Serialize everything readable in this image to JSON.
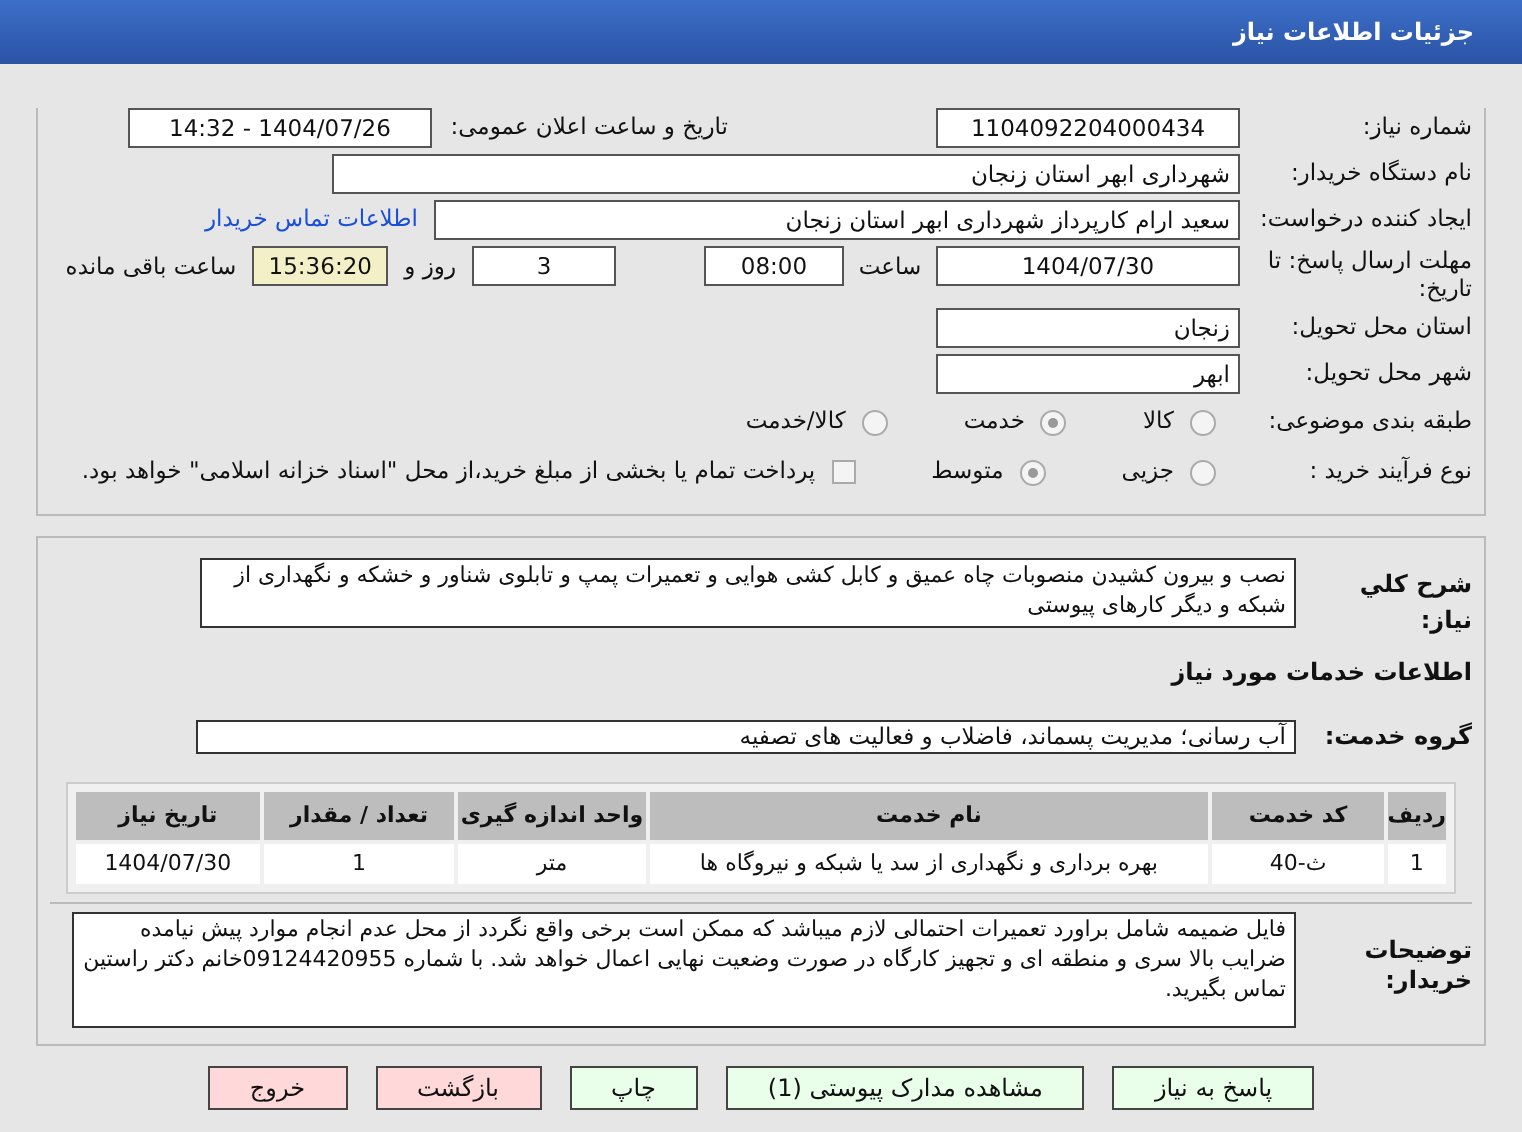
{
  "header": {
    "title": "جزئیات اطلاعات نیاز"
  },
  "need_number": {
    "label": "شماره نیاز:",
    "value": "1104092204000434"
  },
  "announce_date": {
    "label": "تاریخ و ساعت اعلان عمومی:",
    "value": "1404/07/26 - 14:32"
  },
  "buyer_org": {
    "label": "نام دستگاه خریدار:",
    "value": "شهرداری ابهر استان زنجان"
  },
  "requester": {
    "label": "ایجاد کننده درخواست:",
    "value": "سعید ارام کارپرداز  شهرداری ابهر استان زنجان",
    "link": "اطلاعات تماس خریدار"
  },
  "deadline": {
    "label": "مهلت ارسال پاسخ: تا تاریخ:",
    "date": "1404/07/30",
    "time_label": "ساعت",
    "time": "08:00",
    "days": "3",
    "days_label": "روز و",
    "remaining": "15:36:20",
    "remaining_label": "ساعت باقی مانده"
  },
  "province": {
    "label": "استان محل تحویل:",
    "value": "زنجان"
  },
  "city": {
    "label": "شهر محل تحویل:",
    "value": "ابهر"
  },
  "category": {
    "label": "طبقه بندی موضوعی:",
    "options": [
      {
        "label": "کالا",
        "selected": false
      },
      {
        "label": "خدمت",
        "selected": true
      },
      {
        "label": "کالا/خدمت",
        "selected": false
      }
    ]
  },
  "purchase_type": {
    "label": "نوع فرآیند خرید :",
    "options": [
      {
        "label": "جزیی",
        "selected": false
      },
      {
        "label": "متوسط",
        "selected": true
      }
    ],
    "payment_checkbox": {
      "checked": false,
      "label": "پرداخت تمام یا بخشی از مبلغ خرید،از محل \"اسناد خزانه اسلامی\" خواهد بود."
    }
  },
  "summary": {
    "label": "شرح کلي نياز:",
    "value": "نصب و بیرون کشیدن منصوبات چاه عمیق و کابل کشی هوایی و تعمیرات پمپ و تابلوی شناور و خشکه و نگهداری از شبکه و دیگر کارهای پیوستی"
  },
  "services_heading": "اطلاعات خدمات مورد نیاز",
  "service_group": {
    "label": "گروه خدمت:",
    "value": "آب رسانی؛ مدیریت پسماند، فاضلاب و فعالیت های تصفیه"
  },
  "table": {
    "columns": [
      "ردیف",
      "کد خدمت",
      "نام خدمت",
      "واحد اندازه گیری",
      "تعداد / مقدار",
      "تاریخ نیاز"
    ],
    "rows": [
      [
        "1",
        "ث-40",
        "بهره برداری و نگهداری از سد یا شبکه و نیروگاه ها",
        "متر",
        "1",
        "1404/07/30"
      ]
    ]
  },
  "buyer_notes": {
    "label": "توضیحات خریدار:",
    "value": "فایل ضمیمه شامل براورد تعمیرات احتمالی لازم میباشد که ممکن است برخی واقع نگردد از محل عدم انجام موارد پیش نیامده ضرایب بالا سری و منطقه ای و تجهیز کارگاه در صورت وضعیت نهایی اعمال خواهد شد. با شماره 09124420955خانم دکتر راستین تماس بگیرید."
  },
  "buttons": [
    {
      "label": "پاسخ به نیاز",
      "kind": "primary"
    },
    {
      "label": "مشاهده مدارک پیوستی (1)",
      "kind": "primary"
    },
    {
      "label": "چاپ",
      "kind": "primary"
    },
    {
      "label": "بازگشت",
      "kind": "danger"
    },
    {
      "label": "خروج",
      "kind": "danger"
    }
  ]
}
